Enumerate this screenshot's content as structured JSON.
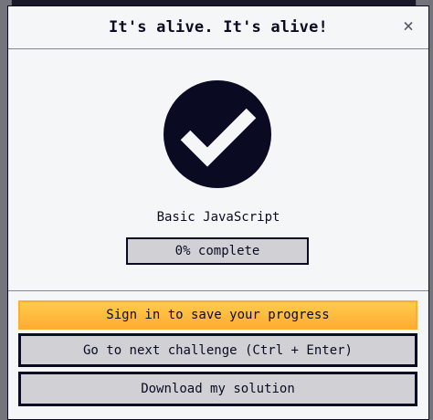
{
  "modal": {
    "title": "It's alive. It's alive!",
    "close_symbol": "×",
    "certification": "Basic JavaScript",
    "progress_percent": 0,
    "progress_label": "0% complete",
    "icon": "check-circle-icon"
  },
  "buttons": {
    "signin": "Sign in to save your progress",
    "next": "Go to next challenge (Ctrl + Enter)",
    "download": "Download my solution"
  },
  "colors": {
    "primary": "#0a0a23",
    "signin_bg": "#feac32",
    "button_bg": "#d0d0d5",
    "surface": "#f5f6f7"
  }
}
